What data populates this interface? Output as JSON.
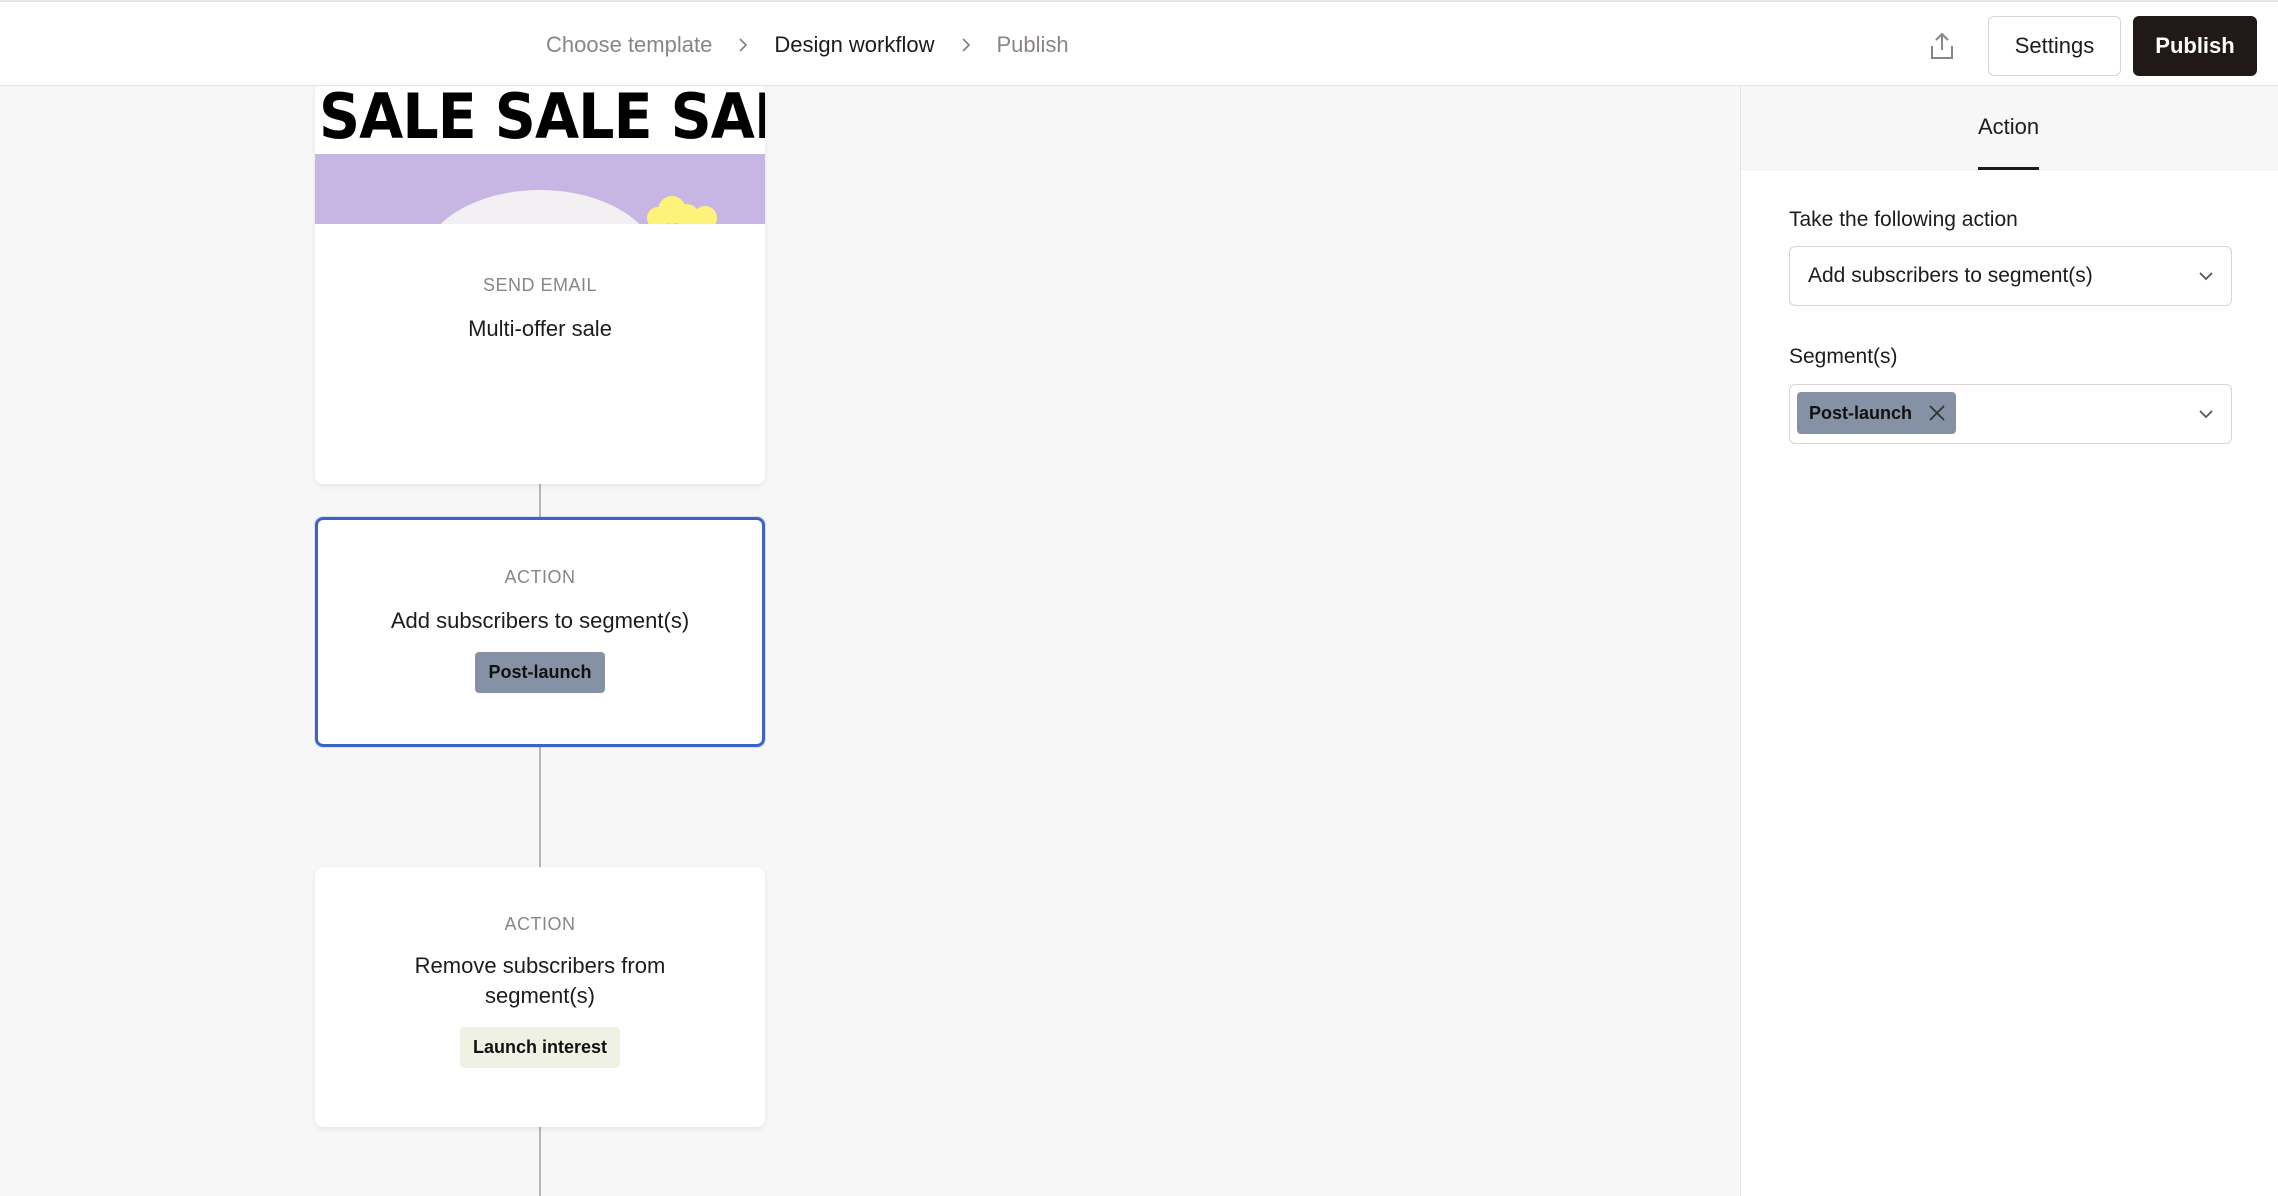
{
  "breadcrumb": {
    "steps": [
      "Choose template",
      "Design workflow",
      "Publish"
    ]
  },
  "header": {
    "share_icon": "share-icon",
    "settings_label": "Settings",
    "publish_label": "Publish"
  },
  "colors": {
    "accent_selected": "#3d63c9",
    "publish_bg": "#211917",
    "tag_slate": "#8592a5",
    "tag_cream": "#eff1e2",
    "banner_purple": "#c7b6e3"
  },
  "workflow": {
    "email": {
      "banner_text": "SALE SALE SALE",
      "kind": "SEND EMAIL",
      "title": "Multi-offer sale"
    },
    "action_add": {
      "kind": "ACTION",
      "title": "Add subscribers to segment(s)",
      "tag": "Post-launch"
    },
    "action_remove": {
      "kind": "ACTION",
      "title_line1": "Remove subscribers from",
      "title_line2": "segment(s)",
      "tag": "Launch interest"
    }
  },
  "panel": {
    "tab": "Action",
    "action_label": "Take the following action",
    "action_value": "Add subscribers to segment(s)",
    "segments_label": "Segment(s)",
    "segments_selected": [
      "Post-launch"
    ]
  }
}
